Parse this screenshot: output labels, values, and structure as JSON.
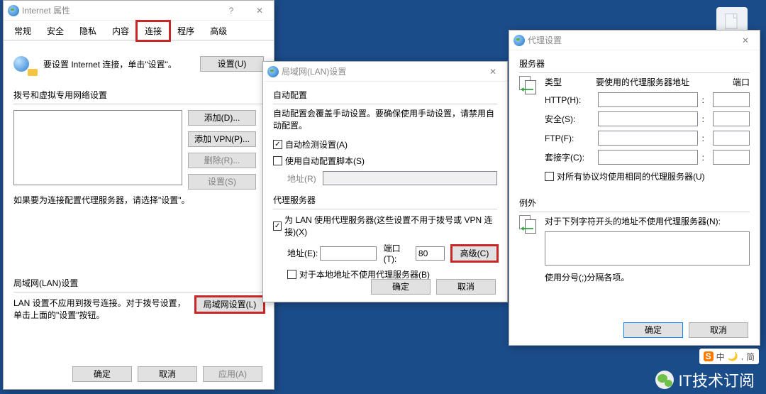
{
  "internet_props": {
    "title": "Internet 属性",
    "tabs": [
      "常规",
      "安全",
      "隐私",
      "内容",
      "连接",
      "程序",
      "高级"
    ],
    "active_tab": 4,
    "setup_line": "要设置 Internet 连接，单击\"设置\"。",
    "btn_setup": "设置(U)",
    "dialup_title": "拨号和虚拟专用网络设置",
    "btn_add": "添加(D)...",
    "btn_add_vpn": "添加 VPN(P)...",
    "btn_remove": "删除(R)...",
    "btn_settings": "设置(S)",
    "proxy_note": "如果要为连接配置代理服务器，请选择\"设置\"。",
    "lan_title": "局域网(LAN)设置",
    "lan_note": "LAN 设置不应用到拨号连接。对于拨号设置，单击上面的\"设置\"按钮。",
    "btn_lan": "局域网设置(L)",
    "btn_ok": "确定",
    "btn_cancel": "取消",
    "btn_apply": "应用(A)"
  },
  "lan_settings": {
    "title": "局域网(LAN)设置",
    "auto_group": "自动配置",
    "auto_note": "自动配置会覆盖手动设置。要确保使用手动设置，请禁用自动配置。",
    "chk_autodetect": "自动检测设置(A)",
    "chk_autoscript": "使用自动配置脚本(S)",
    "lbl_address": "地址(R)",
    "proxy_group": "代理服务器",
    "chk_useproxy": "为 LAN 使用代理服务器(这些设置不用于拨号或 VPN 连接)(X)",
    "lbl_proxy_addr": "地址(E):",
    "lbl_proxy_port": "端口(T):",
    "port_value": "80",
    "btn_advanced": "高级(C)",
    "chk_bypass": "对于本地地址不使用代理服务器(B)",
    "btn_ok": "确定",
    "btn_cancel": "取消"
  },
  "proxy_settings": {
    "title": "代理设置",
    "servers_group": "服务器",
    "col_type": "类型",
    "col_addr": "要使用的代理服务器地址",
    "col_port": "端口",
    "rows": [
      {
        "label": "HTTP(H):"
      },
      {
        "label": "安全(S):"
      },
      {
        "label": "FTP(F):"
      },
      {
        "label": "套接字(C):"
      }
    ],
    "chk_same": "对所有协议均使用相同的代理服务器(U)",
    "exceptions_group": "例外",
    "exceptions_note": "对于下列字符开头的地址不使用代理服务器(N):",
    "exceptions_hint": "使用分号(;)分隔各项。",
    "btn_ok": "确定",
    "btn_cancel": "取消"
  },
  "watermark_text": "IT技术订阅",
  "ime_text": "中",
  "ime_text2": "简"
}
